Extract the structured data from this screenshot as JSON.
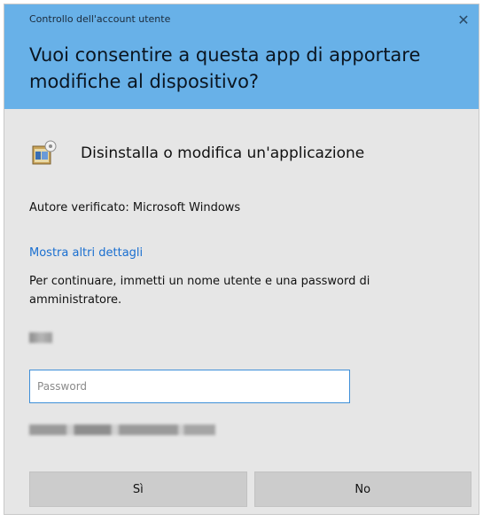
{
  "dialog": {
    "window_title": "Controllo dell'account utente",
    "question": "Vuoi consentire a questa app di apportare modifiche al dispositivo?",
    "app_name": "Disinstalla o modifica un'applicazione",
    "publisher": "Autore verificato: Microsoft Windows",
    "details_link": "Mostra altri dettagli",
    "instructions": "Per continuare, immetti un nome utente e una password di amministratore.",
    "password_placeholder": "Password",
    "yes_label": "Sì",
    "no_label": "No"
  },
  "colors": {
    "header": "#68b1e8",
    "body": "#e6e6e6",
    "link": "#1a6fd0",
    "button": "#cccccc",
    "input_border": "#3e8fd8"
  },
  "icons": {
    "close": "close-icon",
    "app": "uninstall-program-icon"
  }
}
